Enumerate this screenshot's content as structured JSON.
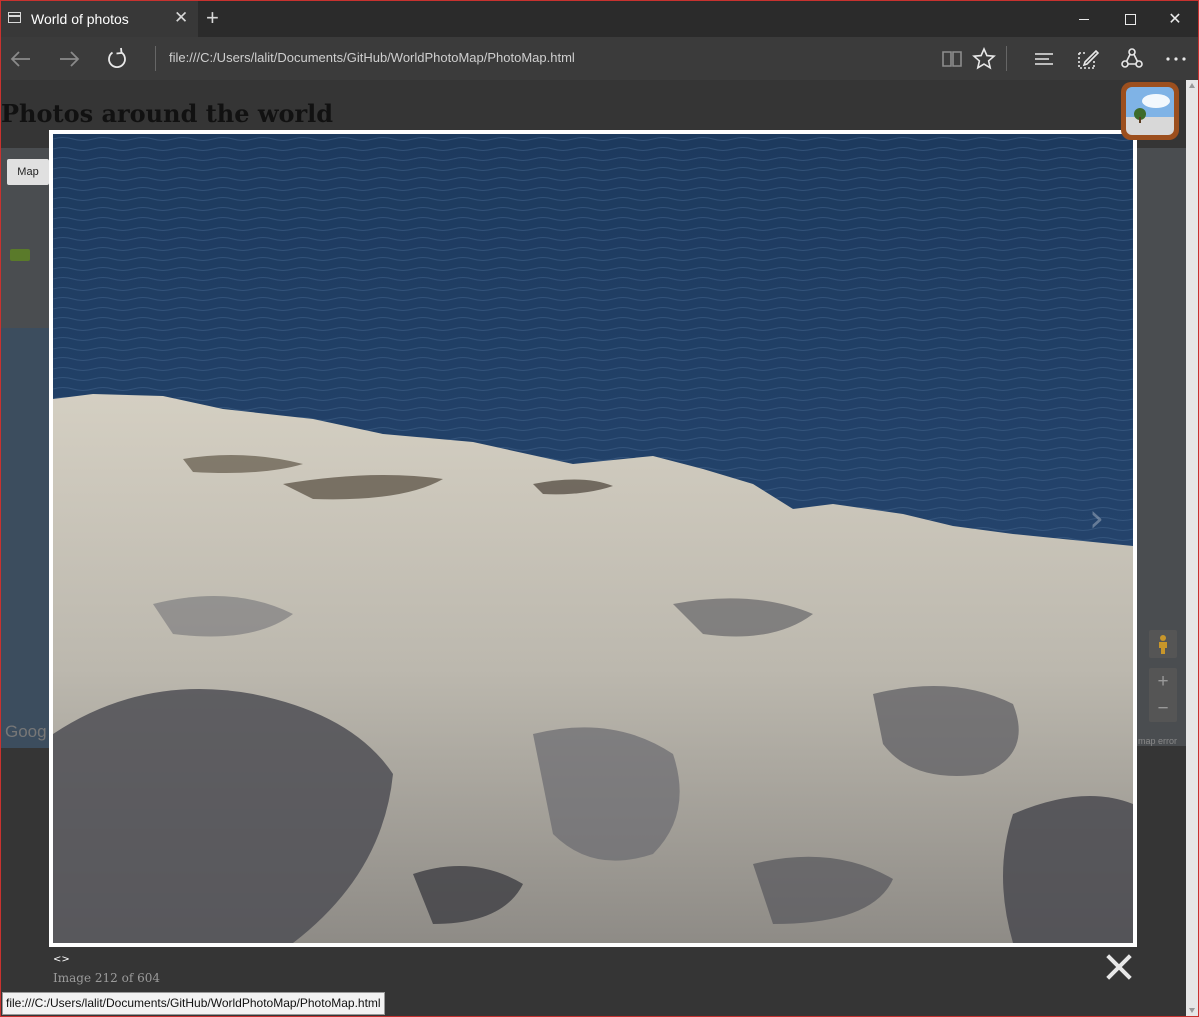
{
  "browser": {
    "tab_title": "World of photos",
    "tab_close_glyph": "✕",
    "new_tab_glyph": "+",
    "window_close_glyph": "✕",
    "address": "file:///C:/Users/lalit/Documents/GitHub/WorldPhotoMap/PhotoMap.html",
    "icons": [
      "back-arrow-icon",
      "forward-arrow-icon",
      "refresh-icon",
      "reading-view-icon",
      "favorite-star-icon",
      "hub-icon",
      "web-note-icon",
      "share-icon",
      "more-icon"
    ]
  },
  "page": {
    "title": "Photos around the world",
    "map": {
      "type_button": "Map",
      "google_logo": "Goog",
      "zoom_in": "+",
      "zoom_out": "−",
      "error_text": "map error"
    }
  },
  "lightbox": {
    "nav_text": "<>",
    "counter": "Image 212 of 604",
    "next_glyph": "›"
  },
  "status_bar": {
    "url": "file:///C:/Users/lalit/Documents/GitHub/WorldPhotoMap/PhotoMap.html"
  },
  "colors": {
    "window_border": "#c8322f",
    "chrome_dark": "#2b2b2b",
    "active_tab": "#383838",
    "nav_bar": "#3b3b3b",
    "water": "#233f63",
    "rock": "#b9b5ab",
    "app_badge": "#9c4f1e"
  }
}
